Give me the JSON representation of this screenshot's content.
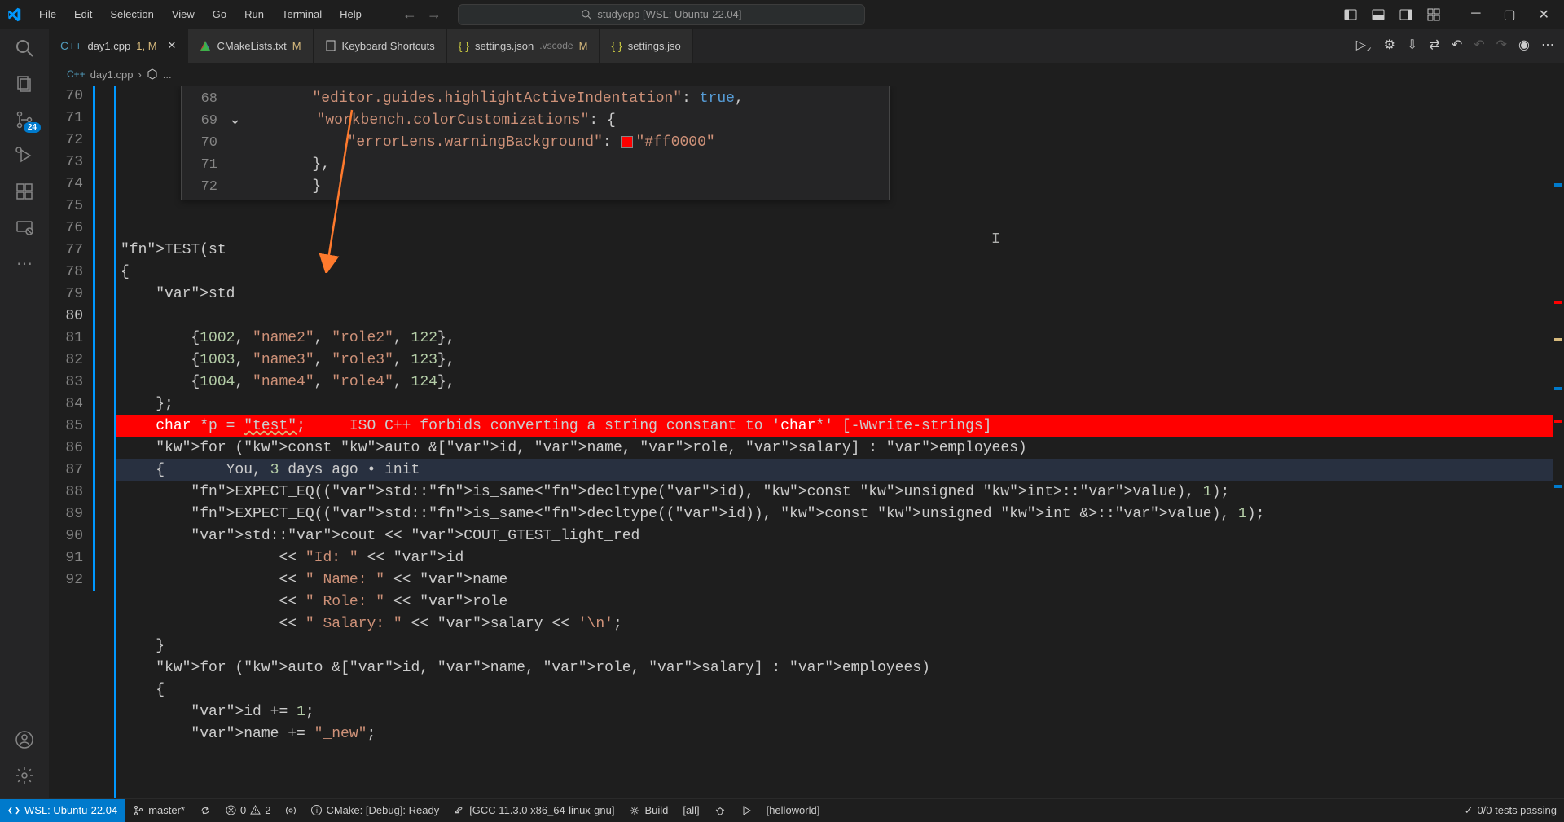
{
  "titlebar": {
    "menu": [
      "File",
      "Edit",
      "Selection",
      "View",
      "Go",
      "Run",
      "Terminal",
      "Help"
    ],
    "search": "studycpp [WSL: Ubuntu-22.04]"
  },
  "activity": {
    "badge": "24"
  },
  "tabs": [
    {
      "icon": "cpp",
      "label": "day1.cpp",
      "modifier": "1, M",
      "close": true
    },
    {
      "icon": "cmake",
      "label": "CMakeLists.txt",
      "modifier": "M"
    },
    {
      "icon": "file",
      "label": "Keyboard Shortcuts"
    },
    {
      "icon": "json",
      "label": "settings.json",
      "detail": ".vscode",
      "modifier": "M"
    },
    {
      "icon": "json",
      "label": "settings.jso"
    }
  ],
  "breadcrumb": {
    "icon": "cpp",
    "file": "day1.cpp",
    "sep": "›",
    "sym": "..."
  },
  "overlay": {
    "lines": [
      {
        "num": "68",
        "content": [
          {
            "t": "str",
            "v": "\"editor.guides.highlightActiveIndentation\""
          },
          {
            "t": "",
            "v": ": "
          },
          {
            "t": "kw",
            "v": "true"
          },
          {
            "t": "",
            "v": ","
          }
        ]
      },
      {
        "num": "69",
        "content": [
          {
            "t": "str",
            "v": "\"workbench.colorCustomizations\""
          },
          {
            "t": "",
            "v": ": {"
          }
        ],
        "chevron": true
      },
      {
        "num": "70",
        "content": [
          {
            "t": "",
            "v": "    "
          },
          {
            "t": "str",
            "v": "\"errorLens.warningBackground\""
          },
          {
            "t": "",
            "v": ": "
          },
          {
            "t": "color",
            "v": ""
          },
          {
            "t": "str",
            "v": "\"#ff0000\""
          }
        ]
      },
      {
        "num": "71",
        "content": [
          {
            "t": "",
            "v": "},"
          }
        ]
      },
      {
        "num": "72",
        "content": [
          {
            "t": "",
            "v": "}"
          }
        ]
      }
    ]
  },
  "code": {
    "lines": [
      {
        "num": "70",
        "txt": "TEST(st"
      },
      {
        "num": "71",
        "txt": "{"
      },
      {
        "num": "72",
        "txt": "    std"
      },
      {
        "num": "73",
        "txt": ""
      },
      {
        "num": "74",
        "txt": "        {1002, \"name2\", \"role2\", 122},"
      },
      {
        "num": "75",
        "txt": "        {1003, \"name3\", \"role3\", 123},"
      },
      {
        "num": "76",
        "txt": "        {1004, \"name4\", \"role4\", 124},"
      },
      {
        "num": "77",
        "txt": "    };"
      },
      {
        "num": "78",
        "err": true,
        "txt": "    char *p = \"test\";     ISO C++ forbids converting a string constant to 'char*' [-Wwrite-strings]"
      },
      {
        "num": "79",
        "txt": "    for (const auto &[id, name, role, salary] : employees)"
      },
      {
        "num": "80",
        "active": true,
        "txt": "    {       You, 3 days ago • init"
      },
      {
        "num": "81",
        "txt": "        EXPECT_EQ((std::is_same<decltype(id), const unsigned int>::value), 1);"
      },
      {
        "num": "82",
        "txt": "        EXPECT_EQ((std::is_same<decltype((id)), const unsigned int &>::value), 1);"
      },
      {
        "num": "83",
        "txt": "        std::cout << COUT_GTEST_light_red"
      },
      {
        "num": "84",
        "txt": "                  << \"Id: \" << id"
      },
      {
        "num": "85",
        "txt": "                  << \" Name: \" << name"
      },
      {
        "num": "86",
        "txt": "                  << \" Role: \" << role"
      },
      {
        "num": "87",
        "txt": "                  << \" Salary: \" << salary << '\\n';"
      },
      {
        "num": "88",
        "txt": "    }"
      },
      {
        "num": "89",
        "txt": "    for (auto &[id, name, role, salary] : employees)"
      },
      {
        "num": "90",
        "txt": "    {"
      },
      {
        "num": "91",
        "txt": "        id += 1;"
      },
      {
        "num": "92",
        "txt": "        name += \"_new\";"
      }
    ]
  },
  "status": {
    "remote": "WSL: Ubuntu-22.04",
    "branch": "master*",
    "sync": "",
    "errors": "0",
    "warnings": "2",
    "cmake": "CMake: [Debug]: Ready",
    "kit": "[GCC 11.3.0 x86_64-linux-gnu]",
    "build": "Build",
    "target_build": "[all]",
    "target_run": "[helloworld]",
    "tests": "0/0 tests passing"
  }
}
